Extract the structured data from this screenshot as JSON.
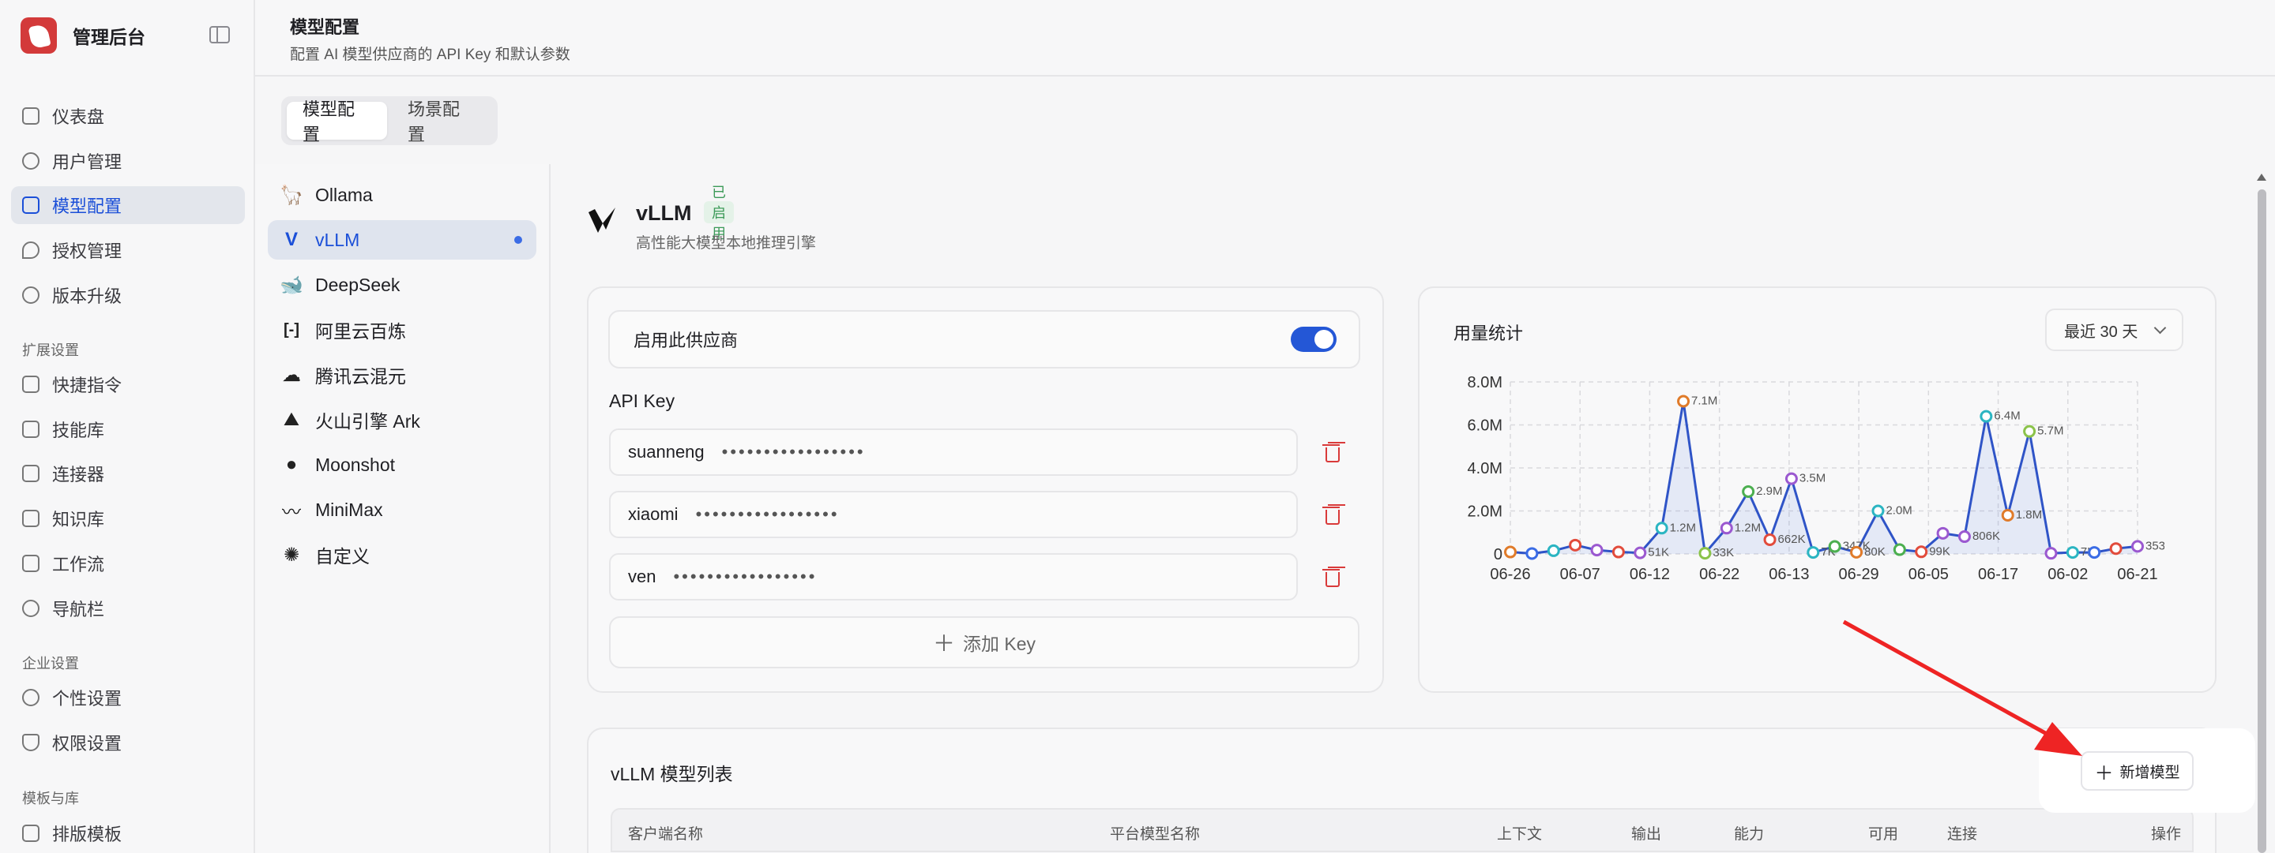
{
  "app": {
    "name": "管理后台"
  },
  "header": {
    "title": "模型配置",
    "subtitle": "配置 AI 模型供应商的 API Key 和默认参数"
  },
  "sidebar": {
    "items": [
      {
        "label": "仪表盘",
        "icon": "dashboard-icon"
      },
      {
        "label": "用户管理",
        "icon": "users-icon"
      },
      {
        "label": "模型配置",
        "icon": "chip-icon",
        "active": true
      },
      {
        "label": "授权管理",
        "icon": "key-icon"
      },
      {
        "label": "版本升级",
        "icon": "refresh-icon"
      }
    ],
    "groups": [
      {
        "label": "扩展设置",
        "items": [
          {
            "label": "快捷指令",
            "icon": "bolt-icon"
          },
          {
            "label": "技能库",
            "icon": "wand-icon"
          },
          {
            "label": "连接器",
            "icon": "plug-icon"
          },
          {
            "label": "知识库",
            "icon": "book-icon"
          },
          {
            "label": "工作流",
            "icon": "workflow-icon"
          },
          {
            "label": "导航栏",
            "icon": "compass-icon"
          }
        ]
      },
      {
        "label": "企业设置",
        "items": [
          {
            "label": "个性设置",
            "icon": "palette-icon"
          },
          {
            "label": "权限设置",
            "icon": "shield-icon"
          }
        ]
      },
      {
        "label": "模板与库",
        "items": [
          {
            "label": "排版模板",
            "icon": "layout-icon"
          }
        ]
      }
    ]
  },
  "tabs": [
    {
      "label": "模型配置",
      "active": true
    },
    {
      "label": "场景配置"
    }
  ],
  "providers": [
    {
      "label": "Ollama",
      "icon": "ollama-icon"
    },
    {
      "label": "vLLM",
      "icon": "vllm-icon",
      "active": true
    },
    {
      "label": "DeepSeek",
      "icon": "deepseek-icon"
    },
    {
      "label": "阿里云百炼",
      "icon": "aliyun-icon"
    },
    {
      "label": "腾讯云混元",
      "icon": "cloud-icon"
    },
    {
      "label": "火山引擎 Ark",
      "icon": "volcano-icon"
    },
    {
      "label": "Moonshot",
      "icon": "moonshot-icon"
    },
    {
      "label": "MiniMax",
      "icon": "waveform-icon"
    },
    {
      "label": "自定义",
      "icon": "custom-icon"
    }
  ],
  "provider": {
    "name": "vLLM",
    "status": "已启用",
    "description": "高性能大模型本地推理引擎",
    "enable_label": "启用此供应商",
    "enabled": true,
    "api_key_label": "API Key",
    "keys": [
      {
        "name": "suanneng",
        "mask": "•••••••••••••••••"
      },
      {
        "name": "xiaomi",
        "mask": "•••••••••••••••••"
      },
      {
        "name": "ven",
        "mask": "•••••••••••••••••"
      }
    ],
    "add_key_label": "添加 Key"
  },
  "usage": {
    "title": "用量统计",
    "range": "最近 30 天"
  },
  "chart_data": {
    "type": "line",
    "title": "",
    "xlabel": "",
    "ylabel": "",
    "y_ticks": [
      "0",
      "2.0M",
      "4.0M",
      "6.0M",
      "8.0M"
    ],
    "ylim": [
      0,
      8000000
    ],
    "x_ticks": [
      "06-26",
      "06-07",
      "06-12",
      "06-22",
      "06-13",
      "06-29",
      "06-05",
      "06-17",
      "06-02",
      "06-21"
    ],
    "grid": true,
    "points": [
      {
        "v": 90000,
        "label": "",
        "color": "#e07b2a"
      },
      {
        "v": 20000,
        "label": "",
        "color": "#3b6ce5"
      },
      {
        "v": 150000,
        "label": "",
        "color": "#2bb5c2"
      },
      {
        "v": 410000,
        "label": "",
        "color": "#e24c3c"
      },
      {
        "v": 180000,
        "label": "",
        "color": "#9b59d0"
      },
      {
        "v": 90000,
        "label": "",
        "color": "#e24c3c"
      },
      {
        "v": 51000,
        "label": "51K",
        "color": "#9b59d0"
      },
      {
        "v": 1200000,
        "label": "1.2M",
        "color": "#2bb5c2"
      },
      {
        "v": 7100000,
        "label": "7.1M",
        "color": "#e07b2a"
      },
      {
        "v": 33000,
        "label": "33K",
        "color": "#8bc34a"
      },
      {
        "v": 1200000,
        "label": "1.2M",
        "color": "#9b59d0"
      },
      {
        "v": 2900000,
        "label": "2.9M",
        "color": "#4caf50"
      },
      {
        "v": 662000,
        "label": "662K",
        "color": "#e24c3c"
      },
      {
        "v": 3500000,
        "label": "3.5M",
        "color": "#9b59d0"
      },
      {
        "v": 70000,
        "label": "7K",
        "color": "#2bb5c2"
      },
      {
        "v": 347000,
        "label": "347K",
        "color": "#4caf50"
      },
      {
        "v": 80000,
        "label": "80K",
        "color": "#e07b2a"
      },
      {
        "v": 2000000,
        "label": "2.0M",
        "color": "#2bb5c2"
      },
      {
        "v": 200000,
        "label": "",
        "color": "#4caf50"
      },
      {
        "v": 99000,
        "label": "99K",
        "color": "#e24c3c"
      },
      {
        "v": 960000,
        "label": "",
        "color": "#9b59d0"
      },
      {
        "v": 806000,
        "label": "806K",
        "color": "#9b59d0"
      },
      {
        "v": 6400000,
        "label": "6.4M",
        "color": "#2bb5c2"
      },
      {
        "v": 1800000,
        "label": "1.8M",
        "color": "#e07b2a"
      },
      {
        "v": 5700000,
        "label": "5.7M",
        "color": "#8bc34a"
      },
      {
        "v": 30000,
        "label": "",
        "color": "#9b59d0"
      },
      {
        "v": 70000,
        "label": "7K",
        "color": "#2bb5c2"
      },
      {
        "v": 70000,
        "label": "",
        "color": "#3b6ce5"
      },
      {
        "v": 250000,
        "label": "",
        "color": "#e24c3c"
      },
      {
        "v": 353000,
        "label": "353K",
        "color": "#9b59d0"
      }
    ]
  },
  "models": {
    "title": "vLLM 模型列表",
    "add_label": "新增模型",
    "columns": [
      "客户端名称",
      "平台模型名称",
      "上下文",
      "输出",
      "能力",
      "可用",
      "连接",
      "操作"
    ]
  },
  "colors": {
    "accent": "#2457d6",
    "danger": "#d93a3a",
    "success": "#3c9a58",
    "annotation": "#ee2424"
  }
}
